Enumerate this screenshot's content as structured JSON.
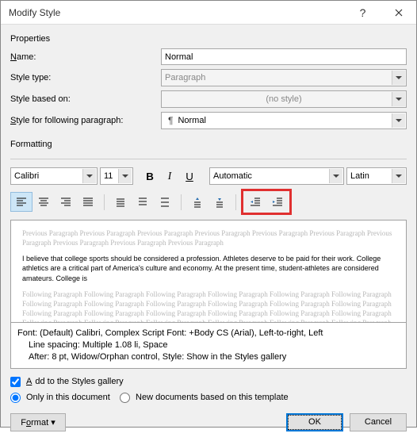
{
  "titlebar": {
    "title": "Modify Style"
  },
  "sections": {
    "properties": "Properties",
    "formatting": "Formatting"
  },
  "props": {
    "name_label_pre": "",
    "name_u": "N",
    "name_label_post": "ame:",
    "name_value": "Normal",
    "type_label": "Style type:",
    "type_value": "Paragraph",
    "based_label": "Style based on:",
    "based_value": "(no style)",
    "following_label_pre": "",
    "following_u": "S",
    "following_label_post": "tyle for following paragraph:",
    "following_value": "Normal"
  },
  "format": {
    "font": "Calibri",
    "size": "11",
    "color_label": "Automatic",
    "script": "Latin"
  },
  "preview": {
    "prev_para": "Previous Paragraph Previous Paragraph Previous Paragraph Previous Paragraph Previous Paragraph Previous Paragraph Previous Paragraph Previous Paragraph Previous Paragraph Previous Paragraph",
    "sample": "I believe that college sports should be considered a profession. Athletes deserve to be paid for their work. College athletics are a critical part of America's culture and economy. At the present time, student-athletes are considered amateurs. College is",
    "next_para": "Following Paragraph Following Paragraph Following Paragraph Following Paragraph Following Paragraph Following Paragraph Following Paragraph Following Paragraph Following Paragraph Following Paragraph Following Paragraph Following Paragraph Following Paragraph Following Paragraph Following Paragraph Following Paragraph Following Paragraph Following Paragraph Following Paragraph Following Paragraph Following Paragraph Following Paragraph Following Paragraph Following Paragraph"
  },
  "description": {
    "line1": "Font: (Default) Calibri, Complex Script Font: +Body CS (Arial), Left-to-right, Left",
    "line2": "Line spacing:  Multiple 1.08 li, Space",
    "line3": "After:  8 pt, Widow/Orphan control, Style: Show in the Styles gallery"
  },
  "options": {
    "add_gallery": "Add to the Styles gallery",
    "only_doc": "Only in this document",
    "new_docs": "New documents based on this template"
  },
  "buttons": {
    "format": "Format ▾",
    "ok": "OK",
    "cancel": "Cancel"
  }
}
